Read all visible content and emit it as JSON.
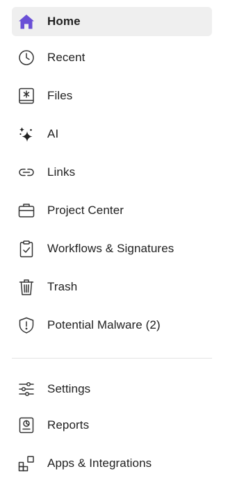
{
  "sidebar": {
    "primary_items": [
      {
        "label": "Home",
        "icon": "home-icon",
        "active": true
      },
      {
        "label": "Recent",
        "icon": "clock-icon",
        "active": false
      },
      {
        "label": "Files",
        "icon": "file-box-icon",
        "active": false
      },
      {
        "label": "AI",
        "icon": "sparkle-icon",
        "active": false
      },
      {
        "label": "Links",
        "icon": "link-icon",
        "active": false
      },
      {
        "label": "Project Center",
        "icon": "briefcase-icon",
        "active": false
      },
      {
        "label": "Workflows & Signatures",
        "icon": "clipboard-check-icon",
        "active": false
      },
      {
        "label": "Trash",
        "icon": "trash-icon",
        "active": false
      },
      {
        "label": "Potential Malware (2)",
        "icon": "shield-alert-icon",
        "active": false
      }
    ],
    "secondary_items": [
      {
        "label": "Settings",
        "icon": "sliders-icon",
        "active": false
      },
      {
        "label": "Reports",
        "icon": "report-icon",
        "active": false
      },
      {
        "label": "Apps & Integrations",
        "icon": "apps-grid-icon",
        "active": false
      }
    ]
  },
  "colors": {
    "accent": "#6a4fd6",
    "active_background": "#efefef",
    "text": "#1f1f1f",
    "icon_stroke": "#333333",
    "divider": "#e3e3e3"
  }
}
